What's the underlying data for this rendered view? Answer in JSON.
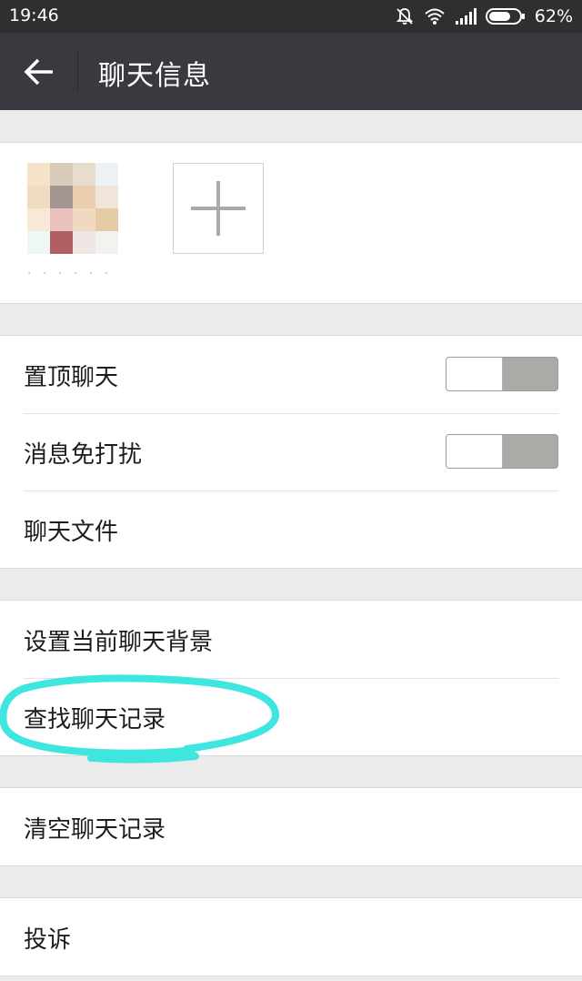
{
  "status_bar": {
    "time": "19:46",
    "battery": "62%",
    "icons": [
      "mute-icon",
      "wifi-icon",
      "signal-icon",
      "battery-icon"
    ]
  },
  "header": {
    "title": "聊天信息",
    "back_icon": "arrow-left-icon"
  },
  "members": {
    "member_name": "· · · · · · · ··",
    "add_icon": "plus-icon"
  },
  "settings": {
    "sticky_label": "置顶聊天",
    "sticky_on": false,
    "mute_label": "消息免打扰",
    "mute_on": false,
    "files_label": "聊天文件",
    "background_label": "设置当前聊天背景",
    "search_label": "查找聊天记录",
    "clear_label": "清空聊天记录",
    "report_label": "投诉"
  },
  "colors": {
    "header_bg": "#393a3f",
    "status_bg": "#2e2f31",
    "page_bg": "#ebebeb",
    "toggle_off": "#a9aba6",
    "annotation": "#3fe6e0"
  }
}
